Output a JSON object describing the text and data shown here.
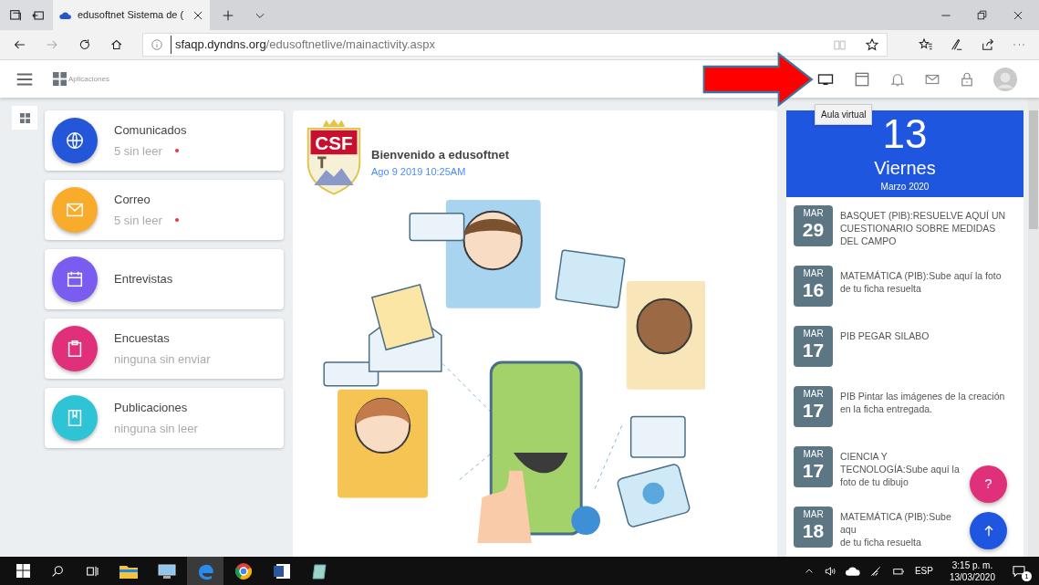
{
  "browser": {
    "tab_title": "edusoftnet Sistema de (",
    "url_host": "sfaqp.dyndns.org",
    "url_path": "/edusoftnetlive/mainactivity.aspx"
  },
  "header": {
    "apps_label": "Aplicaciones",
    "tooltip": "Aula virtual"
  },
  "modules": [
    {
      "kind": "globe",
      "title": "Comunicados",
      "subtitle": "5 sin leer",
      "unread": true,
      "color": "#2356d9"
    },
    {
      "kind": "mail",
      "title": "Correo",
      "subtitle": "5 sin leer",
      "unread": true,
      "color": "#f9ab2b"
    },
    {
      "kind": "calendar",
      "title": "Entrevistas",
      "color": "#7b5cf0"
    },
    {
      "kind": "clipboard",
      "title": "Encuestas",
      "subtitle": "ninguna sin enviar",
      "unread": false,
      "color": "#e0307a"
    },
    {
      "kind": "book",
      "title": "Publicaciones",
      "subtitle": "ninguna sin leer",
      "unread": false,
      "color": "#2ec4d6"
    }
  ],
  "welcome": {
    "logo_text": "CSF",
    "title": "Bienvenido a edusoftnet",
    "date": "Ago 9 2019 10:25AM"
  },
  "calendar": {
    "day": "13",
    "weekday": "Viernes",
    "month_year": "Marzo 2020",
    "events": [
      {
        "month": "MAR",
        "day": "29",
        "text": "BASQUET (PIB):RESUELVE AQUÍ UN CUESTIONARIO SOBRE MEDIDAS DEL CAMPO"
      },
      {
        "month": "MAR",
        "day": "16",
        "text": "MATEMÁTICA (PIB):Sube aquí la foto de tu ficha resuelta"
      },
      {
        "month": "MAR",
        "day": "17",
        "text": "PIB PEGAR SILABO"
      },
      {
        "month": "MAR",
        "day": "17",
        "text": "PIB Pintar las imágenes de la creación en la ficha entregada."
      },
      {
        "month": "MAR",
        "day": "17",
        "text": "CIENCIA Y TECNOLOGÍA:Sube aquí la foto de tu dibujo"
      },
      {
        "month": "MAR",
        "day": "18",
        "text": "MATEMÁTICA (PIB):Sube aqu",
        "text_2": "de tu ficha resuelta"
      }
    ]
  },
  "fab": {
    "help": "?"
  },
  "taskbar": {
    "language": "ESP",
    "time": "3:15 p. m.",
    "date": "13/03/2020",
    "notifications": "1"
  }
}
